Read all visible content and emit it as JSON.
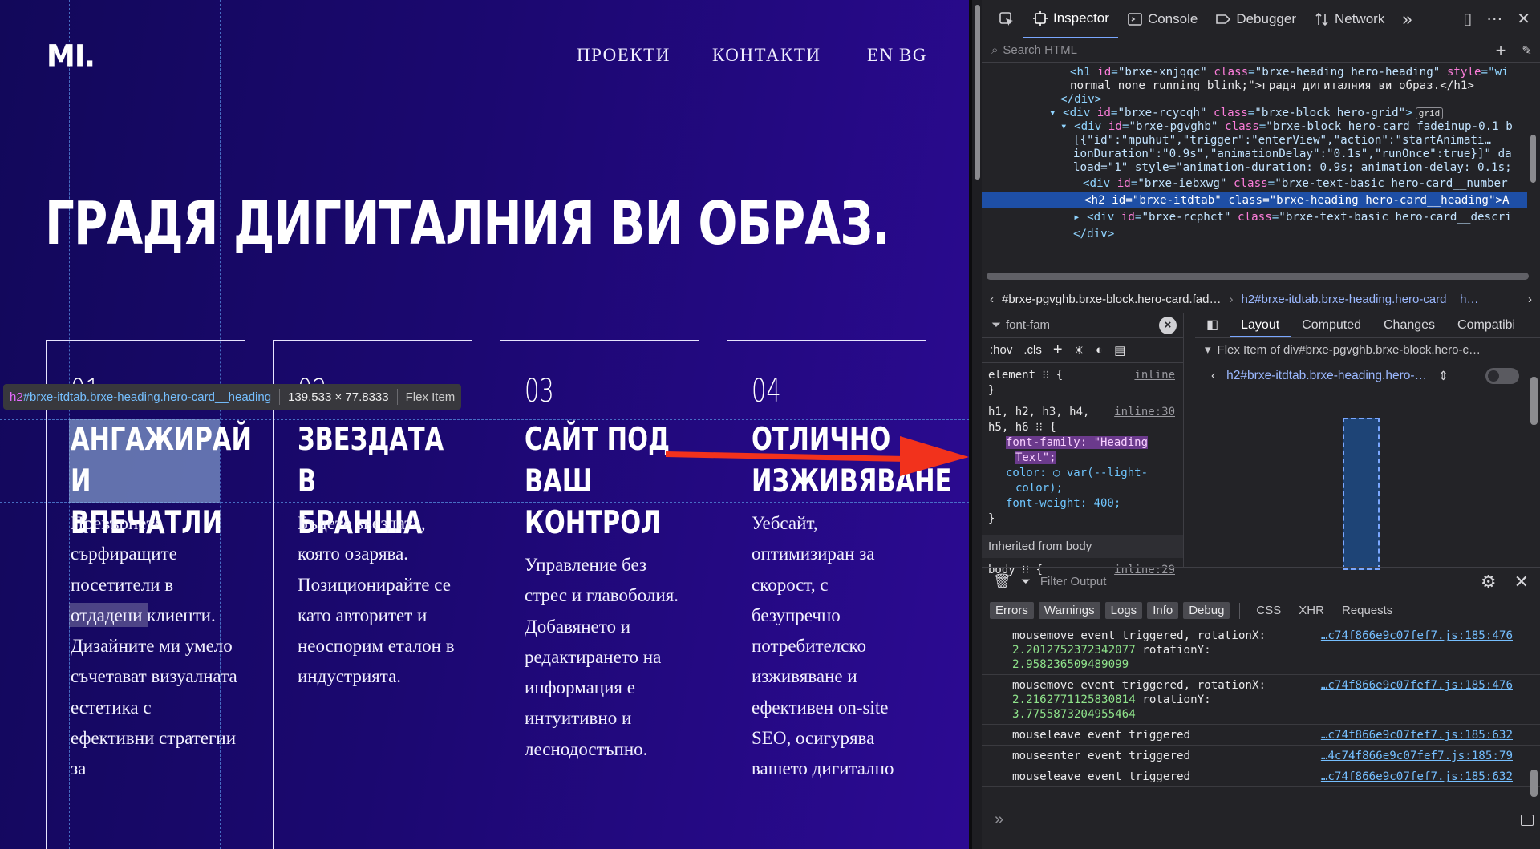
{
  "site": {
    "logo": "MI.",
    "nav": {
      "projects": "ПРОЕКТИ",
      "contacts": "КОНТАКТИ",
      "en": "EN",
      "bg": "BG"
    },
    "hero_title": "ГРАДЯ ДИГИТАЛНИЯ ВИ ОБРАЗ.",
    "cards": [
      {
        "num": "01",
        "heading": "АНГАЖИРАЙ\nИ ВПЕЧАТЛИ",
        "desc": "Превърнете сърфиращите посетители в отдадени клиенти. Дизайните ми умело съчетават визуалната естетика с ефективни стратегии за"
      },
      {
        "num": "02",
        "heading": "ЗВЕЗДАТА В\nБРАНША",
        "desc": "Бъдете звездата, която озарява. Позиционирайте се като авторитет и неоспорим еталон в индустрията."
      },
      {
        "num": "03",
        "heading": "САЙТ ПОД\nВАШ\nКОНТРОЛ",
        "desc": "Управление без стрес и главоболия. Добавянето и редактирането на информация е интуитивно и леснодостъпно."
      },
      {
        "num": "04",
        "heading": "ОТЛИЧНО\nИЗЖИВЯВАНЕ",
        "desc": "Уебсайт, оптимизиран за скорост, с безупречно потребителско изживяване и ефективен on-site SEO, осигурява вашето дигитално"
      }
    ],
    "tooltip": {
      "tag": "h2",
      "selector": "#brxe-itdtab.brxe-heading.hero-card__heading",
      "size": "139.533 × 77.8333",
      "kind": "Flex Item"
    }
  },
  "devtools": {
    "tabs": [
      "Inspector",
      "Console",
      "Debugger",
      "Network"
    ],
    "search_placeholder": "Search HTML",
    "markup": [
      {
        "indent": 1,
        "html": "<h1 id=\"brxe-xnjqqc\" class=\"brxe-heading hero-heading\" style=\"wi",
        "kind": "line"
      },
      {
        "indent": 1,
        "text": "normal none running blink;\">градя дигиталния ви образ.</h1>",
        "kind": "text"
      },
      {
        "indent": 0,
        "text": "</div>",
        "kind": "close"
      },
      {
        "indent": 0,
        "text": "<div id=\"brxe-rcycqh\" class=\"brxe-block hero-grid\">",
        "kind": "open",
        "badge": "grid"
      },
      {
        "indent": 1,
        "text": "<div id=\"brxe-pgvghb\" class=\"brxe-block hero-card fadeinup-0.1 b",
        "kind": "open"
      },
      {
        "indent": 1,
        "text": "[{\"id\":\"mpuhut\",\"trigger\":\"enterView\",\"action\":\"startAnimati…",
        "kind": "text"
      },
      {
        "indent": 1,
        "text": "ionDuration\":\"0.9s\",\"animationDelay\":\"0.1s\",\"runOnce\":true}]\" da",
        "kind": "text"
      },
      {
        "indent": 1,
        "text": "load=\"1\" style=\"animation-duration: 0.9s; animation-delay: 0.1s;",
        "kind": "text"
      },
      {
        "indent": 2,
        "text": "<div id=\"brxe-iebxwg\" class=\"brxe-text-basic hero-card__number",
        "kind": "line"
      },
      {
        "indent": 2,
        "text": "<h2 id=\"brxe-itdtab\" class=\"brxe-heading hero-card__heading\">A",
        "kind": "selected"
      },
      {
        "indent": 2,
        "text": "<div id=\"brxe-rcphct\" class=\"brxe-text-basic hero-card__descri",
        "kind": "open"
      },
      {
        "indent": 1,
        "text": "</div>",
        "kind": "close"
      }
    ],
    "breadcrumb": {
      "item1": "#brxe-pgvghb.brxe-block.hero-card.fad…",
      "item2": "h2#brxe-itdtab.brxe-heading.hero-card__h…"
    },
    "rules": {
      "filter": "font-fam",
      "element_rule": "element ⁝⁝ {",
      "element_meta": "inline",
      "selector_line1": "h1, h2, h3, h4,",
      "selector_line2": "h5, h6 ⁝⁝ {",
      "selector_meta": "inline:30",
      "font_family_prop": "font-family: \"Heading",
      "font_family_prop2": "Text\";",
      "color_prop": "color: ○ var(--light-",
      "color_prop2": "color);",
      "weight_prop": "font-weight: 400;",
      "inherited": "Inherited from body",
      "body_rule": "body ⁝⁝ {",
      "body_meta": "inline:29"
    },
    "layout": {
      "tabs": [
        "Layout",
        "Computed",
        "Changes",
        "Compatibi"
      ],
      "flex_item_of": "Flex Item of div#brxe-pgvghb.brxe-block.hero-c…",
      "selected": "h2#brxe-itdtab.brxe-heading.hero-…"
    },
    "console": {
      "filter_placeholder": "Filter Output",
      "levels": [
        "Errors",
        "Warnings",
        "Logs",
        "Info",
        "Debug"
      ],
      "types": [
        "CSS",
        "XHR",
        "Requests"
      ],
      "messages": [
        {
          "line1": "mousemove event triggered, rotationX:",
          "num1": "2.2012752372342077",
          "mid": " rotationY:",
          "num2": "2.958236509489099",
          "src": "…c74f866e9c07fef7.js:185:476"
        },
        {
          "line1": "mousemove event triggered, rotationX:",
          "num1": "2.2162771125830814",
          "mid": " rotationY:",
          "num2": "3.7755873204955464",
          "src": "…c74f866e9c07fef7.js:185:476"
        },
        {
          "line1": "mouseleave event triggered",
          "src": "…c74f866e9c07fef7.js:185:632"
        },
        {
          "line1": "mouseenter event triggered",
          "src": "…4c74f866e9c07fef7.js:185:79"
        },
        {
          "line1": "mouseleave event triggered",
          "src": "…c74f866e9c07fef7.js:185:632"
        }
      ],
      "prompt": "»"
    }
  }
}
